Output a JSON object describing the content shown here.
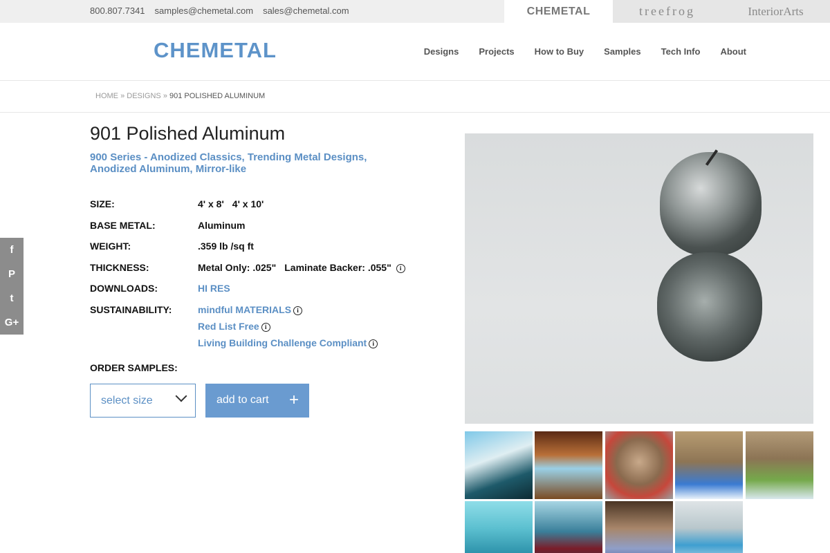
{
  "topbar": {
    "phone": "800.807.7341",
    "email1": "samples@chemetal.com",
    "email2": "sales@chemetal.com",
    "brands": [
      "CHEMETAL",
      "treefrog",
      "InteriorArts"
    ]
  },
  "header": {
    "logo": "CHEMETAL",
    "nav": [
      "Designs",
      "Projects",
      "How to Buy",
      "Samples",
      "Tech Info",
      "About"
    ]
  },
  "breadcrumb": {
    "home": "HOME",
    "sep": "»",
    "designs": "DESIGNS",
    "current": "901 POLISHED ALUMINUM"
  },
  "product": {
    "title": "901 Polished Aluminum",
    "categories": "900 Series - Anodized Classics, Trending Metal Designs, Anodized Aluminum, Mirror-like",
    "specs": {
      "size_label": "SIZE:",
      "size_1": "4' x 8'",
      "size_2": "4' x 10'",
      "base_metal_label": "BASE METAL:",
      "base_metal": "Aluminum",
      "weight_label": "WEIGHT:",
      "weight": ".359 lb /sq ft",
      "thickness_label": "THICKNESS:",
      "thickness_metal": "Metal Only: .025\"",
      "thickness_laminate": "Laminate Backer: .055\"",
      "downloads_label": "DOWNLOADS:",
      "downloads": "HI RES",
      "sustainability_label": "SUSTAINABILITY:",
      "sustainability": [
        "mindful MATERIALS",
        "Red List Free",
        "Living Building Challenge Compliant"
      ]
    },
    "order_label": "ORDER SAMPLES:",
    "select_placeholder": "select size",
    "add_to_cart": "add to cart",
    "plus": "+"
  },
  "social": [
    "f",
    "P",
    "t",
    "G+"
  ],
  "info_glyph": "i",
  "icons": [
    "facebook-icon",
    "pinterest-icon",
    "twitter-icon",
    "google-plus-icon",
    "info-icon",
    "chevron-down-icon",
    "plus-icon"
  ],
  "colors": {
    "accent": "#5b8fc4",
    "button": "#6a9bd0",
    "social_bar": "#8c8c8c"
  }
}
